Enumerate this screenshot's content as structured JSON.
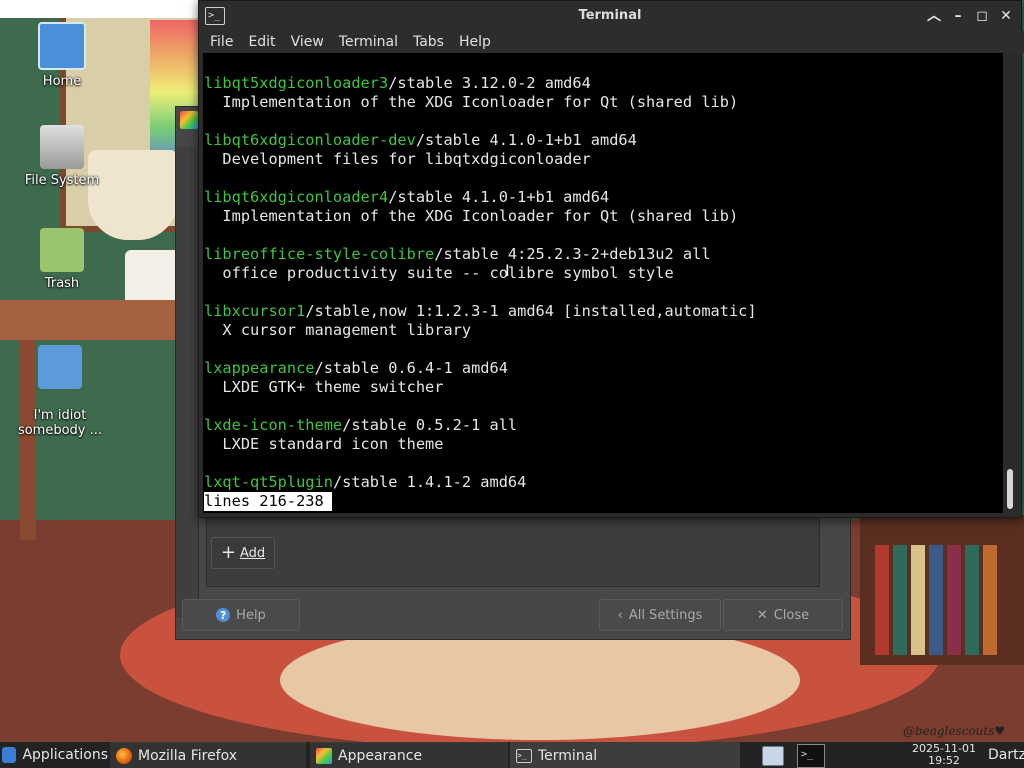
{
  "desktop": {
    "icons": [
      {
        "label": "Home",
        "icon": "home-icon"
      },
      {
        "label": "File System",
        "icon": "drive-icon"
      },
      {
        "label": "Trash",
        "icon": "trash-icon"
      },
      {
        "label": "I'm idiot\nsomebody ...",
        "icon": "folder-icon"
      }
    ],
    "wallpaper_signature": "@beaglescouts♥"
  },
  "terminal": {
    "title": "Terminal",
    "menu": [
      "File",
      "Edit",
      "View",
      "Terminal",
      "Tabs",
      "Help"
    ],
    "lines": [
      {
        "pkg": "libqt5xdgiconloader3",
        "rest": "/stable 3.12.0-2 amd64"
      },
      {
        "pkg": "",
        "rest": "  Implementation of the XDG Iconloader for Qt (shared lib)"
      },
      {
        "pkg": "",
        "rest": ""
      },
      {
        "pkg": "libqt6xdgiconloader-dev",
        "rest": "/stable 4.1.0-1+b1 amd64"
      },
      {
        "pkg": "",
        "rest": "  Development files for libqtxdgiconloader"
      },
      {
        "pkg": "",
        "rest": ""
      },
      {
        "pkg": "libqt6xdgiconloader4",
        "rest": "/stable 4.1.0-1+b1 amd64"
      },
      {
        "pkg": "",
        "rest": "  Implementation of the XDG Iconloader for Qt (shared lib)"
      },
      {
        "pkg": "",
        "rest": ""
      },
      {
        "pkg": "libreoffice-style-colibre",
        "rest": "/stable 4:25.2.3-2+deb13u2 all"
      },
      {
        "pkg": "",
        "rest": "  office productivity suite -- colibre symbol style"
      },
      {
        "pkg": "",
        "rest": ""
      },
      {
        "pkg": "libxcursor1",
        "rest": "/stable,now 1:1.2.3-1 amd64 [installed,automatic]"
      },
      {
        "pkg": "",
        "rest": "  X cursor management library"
      },
      {
        "pkg": "",
        "rest": ""
      },
      {
        "pkg": "lxappearance",
        "rest": "/stable 0.6.4-1 amd64"
      },
      {
        "pkg": "",
        "rest": "  LXDE GTK+ theme switcher"
      },
      {
        "pkg": "",
        "rest": ""
      },
      {
        "pkg": "lxde-icon-theme",
        "rest": "/stable 0.5.2-1 all"
      },
      {
        "pkg": "",
        "rest": "  LXDE standard icon theme"
      },
      {
        "pkg": "",
        "rest": ""
      },
      {
        "pkg": "lxqt-qt5plugin",
        "rest": "/stable 1.4.1-2 amd64"
      }
    ],
    "status_line": "lines 216-238",
    "colors": {
      "package": "#3fc43f",
      "text": "#e6e6e6",
      "background": "#000000"
    }
  },
  "appearance": {
    "add_label": "Add",
    "help_label": "Help",
    "all_settings_label": "All Settings",
    "close_label": "Close"
  },
  "taskbar": {
    "applications_label": "Applications",
    "tasks": [
      {
        "label": "Mozilla Firefox",
        "icon": "firefox-icon"
      },
      {
        "label": "Appearance",
        "icon": "appearance-icon"
      },
      {
        "label": "Terminal",
        "icon": "terminal-icon"
      }
    ],
    "clock_date": "2025-11-01",
    "clock_time": "19:52",
    "user": "Dartz"
  }
}
